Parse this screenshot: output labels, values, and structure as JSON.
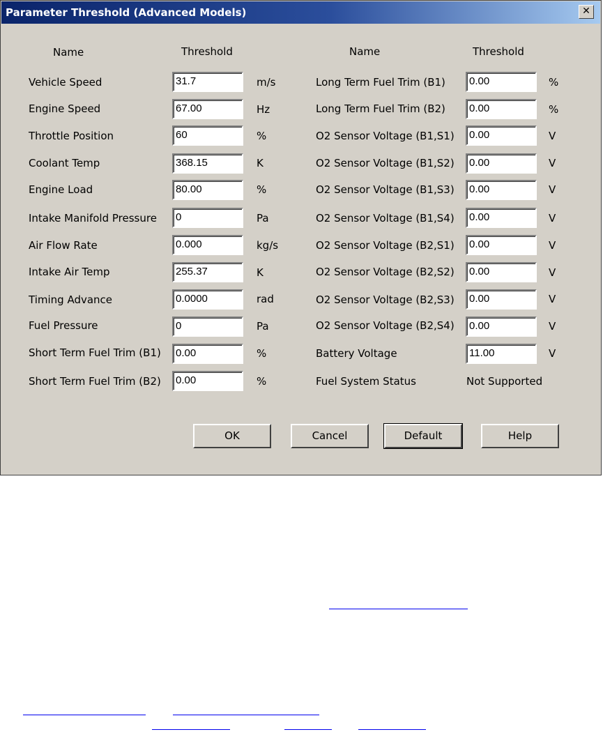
{
  "window": {
    "title": "Parameter Threshold  (Advanced Models)",
    "close_glyph": "✕"
  },
  "headers": {
    "left_name": "Name",
    "left_threshold": "Threshold",
    "right_name": "Name",
    "right_threshold": "Threshold"
  },
  "left_params": [
    {
      "name": "Vehicle Speed",
      "value": "31.7",
      "unit": "m/s"
    },
    {
      "name": "Engine Speed",
      "value": "67.00",
      "unit": "Hz"
    },
    {
      "name": "Throttle Position",
      "value": "60",
      "unit": "%"
    },
    {
      "name": "Coolant Temp",
      "value": "368.15",
      "unit": "K"
    },
    {
      "name": "Engine Load",
      "value": "80.00",
      "unit": "%"
    },
    {
      "name": "Intake Manifold Pressure",
      "value": "0",
      "unit": "Pa"
    },
    {
      "name": "Air Flow Rate",
      "value": "0.000",
      "unit": "kg/s"
    },
    {
      "name": "Intake Air Temp",
      "value": "255.37",
      "unit": "K"
    },
    {
      "name": "Timing Advance",
      "value": "0.0000",
      "unit": "rad"
    },
    {
      "name": "Fuel Pressure",
      "value": "0",
      "unit": "Pa"
    },
    {
      "name": "Short Term Fuel Trim (B1)",
      "value": "0.00",
      "unit": "%"
    },
    {
      "name": "Short Term Fuel Trim (B2)",
      "value": "0.00",
      "unit": "%"
    }
  ],
  "right_params": [
    {
      "name": "Long Term Fuel Trim (B1)",
      "value": "0.00",
      "unit": "%"
    },
    {
      "name": "Long Term Fuel Trim (B2)",
      "value": "0.00",
      "unit": "%"
    },
    {
      "name": "O2 Sensor Voltage (B1,S1)",
      "value": "0.00",
      "unit": "V"
    },
    {
      "name": "O2 Sensor Voltage (B1,S2)",
      "value": "0.00",
      "unit": "V"
    },
    {
      "name": "O2 Sensor Voltage (B1,S3)",
      "value": "0.00",
      "unit": "V"
    },
    {
      "name": "O2 Sensor Voltage (B1,S4)",
      "value": "0.00",
      "unit": "V"
    },
    {
      "name": "O2 Sensor Voltage (B2,S1)",
      "value": "0.00",
      "unit": "V"
    },
    {
      "name": "O2 Sensor Voltage (B2,S2)",
      "value": "0.00",
      "unit": "V"
    },
    {
      "name": "O2 Sensor Voltage (B2,S3)",
      "value": "0.00",
      "unit": "V"
    },
    {
      "name": "O2 Sensor Voltage (B2,S4)",
      "value": "0.00",
      "unit": "V"
    },
    {
      "name": "Battery Voltage",
      "value": "11.00",
      "unit": "V"
    }
  ],
  "fuel_system": {
    "name": "Fuel System Status",
    "status": "Not Supported"
  },
  "buttons": {
    "ok": "OK",
    "cancel": "Cancel",
    "default": "Default",
    "help": "Help"
  }
}
